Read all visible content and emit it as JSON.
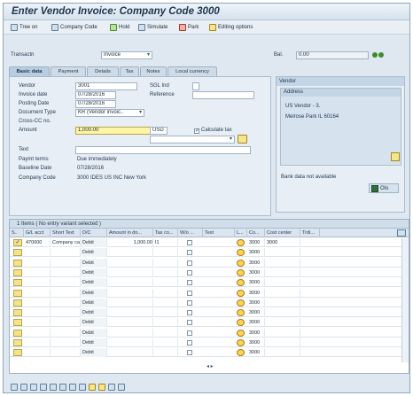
{
  "window": {
    "title": "Enter Vendor Invoice: Company Code 3000"
  },
  "app_toolbar": [
    {
      "label": "Tree on",
      "icon": "tree-icon"
    },
    {
      "label": "Company Code",
      "icon": "company-code-icon"
    },
    {
      "label": "Hold",
      "icon": "hold-icon"
    },
    {
      "label": "Simulate",
      "icon": "simulate-icon"
    },
    {
      "label": "Park",
      "icon": "park-icon"
    },
    {
      "label": "Editing options",
      "icon": "editing-options-icon"
    }
  ],
  "header": {
    "transactn_label": "Transactn",
    "transactn_value": "Invoice",
    "bal_label": "Bal.",
    "bal_value": "0.00"
  },
  "tabs": [
    "Basic data",
    "Payment",
    "Details",
    "Tax",
    "Notes",
    "Local currency"
  ],
  "basic": {
    "vendor_label": "Vendor",
    "vendor_value": "3001",
    "sgl_label": "SGL Ind",
    "invoice_date_label": "Invoice date",
    "invoice_date_value": "07/28/2016",
    "reference_label": "Reference",
    "posting_date_label": "Posting Date",
    "posting_date_value": "07/28/2016",
    "doc_type_label": "Document Type",
    "doc_type_value": "KR (Vendor invoic..",
    "cross_cc_label": "Cross-CC no.",
    "amount_label": "Amount",
    "amount_value": "1,000.00",
    "currency_value": "USD",
    "calc_tax_label": "Calculate tax",
    "text_label": "Text",
    "paymt_terms_label": "Paymt terms",
    "paymt_terms_value": "Due immediately",
    "baseline_label": "Baseline Date",
    "baseline_value": "07/28/2016",
    "company_code_label": "Company Code",
    "company_code_value": "3000 IDES US INC New York"
  },
  "vendor_panel": {
    "title": "Vendor",
    "address_title": "Address",
    "line1": "US Vendor - 3.",
    "line2": "Melrose Park IL 60164",
    "bank_text": "Bank data not available",
    "oi_label": "OIs"
  },
  "table": {
    "caption": "1 Items ( No entry variant selected )",
    "headers": [
      "S..",
      "G/L acct",
      "Short Text",
      "D/C",
      "Amount in do...",
      "Tax co...",
      "W/o ...",
      "Text",
      "L...",
      "Co...",
      "Cost center",
      "Trdi..."
    ],
    "rows": [
      {
        "gl": "470000",
        "short_text": "Company ca",
        "dc": "Debit",
        "amount": "1,000.00",
        "tax": "I1",
        "co": "3000",
        "cost_center": "3000"
      },
      {
        "gl": "",
        "short_text": "",
        "dc": "Debit",
        "amount": "",
        "tax": "",
        "co": "3000",
        "cost_center": ""
      },
      {
        "gl": "",
        "short_text": "",
        "dc": "Debit",
        "amount": "",
        "tax": "",
        "co": "3000",
        "cost_center": ""
      },
      {
        "gl": "",
        "short_text": "",
        "dc": "Debit",
        "amount": "",
        "tax": "",
        "co": "3000",
        "cost_center": ""
      },
      {
        "gl": "",
        "short_text": "",
        "dc": "Debit",
        "amount": "",
        "tax": "",
        "co": "3000",
        "cost_center": ""
      },
      {
        "gl": "",
        "short_text": "",
        "dc": "Debit",
        "amount": "",
        "tax": "",
        "co": "3000",
        "cost_center": ""
      },
      {
        "gl": "",
        "short_text": "",
        "dc": "Debit",
        "amount": "",
        "tax": "",
        "co": "3000",
        "cost_center": ""
      },
      {
        "gl": "",
        "short_text": "",
        "dc": "Debit",
        "amount": "",
        "tax": "",
        "co": "3000",
        "cost_center": ""
      },
      {
        "gl": "",
        "short_text": "",
        "dc": "Debit",
        "amount": "",
        "tax": "",
        "co": "3000",
        "cost_center": ""
      },
      {
        "gl": "",
        "short_text": "",
        "dc": "Debit",
        "amount": "",
        "tax": "",
        "co": "3000",
        "cost_center": ""
      },
      {
        "gl": "",
        "short_text": "",
        "dc": "Debit",
        "amount": "",
        "tax": "",
        "co": "3000",
        "cost_center": ""
      },
      {
        "gl": "",
        "short_text": "",
        "dc": "Debit",
        "amount": "",
        "tax": "",
        "co": "3000",
        "cost_center": ""
      }
    ]
  }
}
